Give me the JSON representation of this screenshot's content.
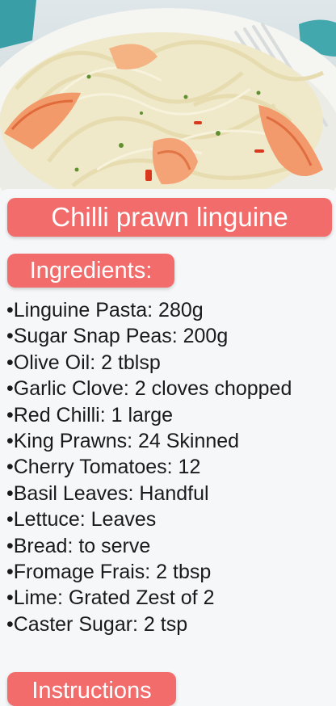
{
  "recipe": {
    "title": "Chilli prawn linguine",
    "ingredients_heading": "Ingredients:",
    "ingredients": [
      "•Linguine Pasta: 280g",
      "•Sugar Snap Peas: 200g",
      "•Olive Oil: 2 tblsp",
      "•Garlic Clove: 2 cloves chopped",
      "•Red Chilli: 1 large",
      "•King Prawns: 24 Skinned",
      "•Cherry Tomatoes: 12",
      "•Basil Leaves: Handful",
      "•Lettuce: Leaves",
      "•Bread: to serve",
      "•Fromage Frais: 2 tbsp",
      "•Lime: Grated Zest of 2",
      "•Caster Sugar: 2 tsp"
    ],
    "instructions_heading": "Instructions"
  },
  "colors": {
    "accent": "#f26c6c",
    "background": "#f6f7f9",
    "text": "#1a1a1a"
  }
}
